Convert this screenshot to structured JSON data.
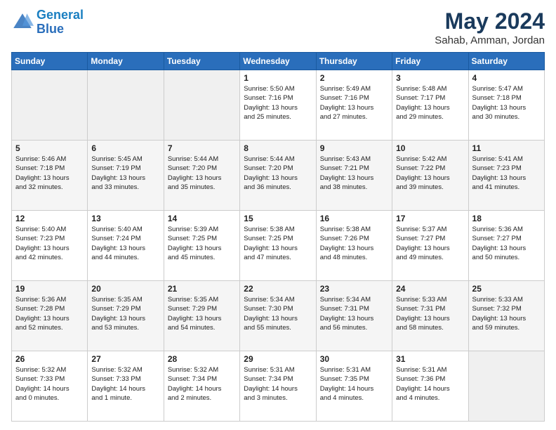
{
  "logo": {
    "line1": "General",
    "line2": "Blue"
  },
  "title": "May 2024",
  "subtitle": "Sahab, Amman, Jordan",
  "weekdays": [
    "Sunday",
    "Monday",
    "Tuesday",
    "Wednesday",
    "Thursday",
    "Friday",
    "Saturday"
  ],
  "weeks": [
    [
      {
        "day": "",
        "info": ""
      },
      {
        "day": "",
        "info": ""
      },
      {
        "day": "",
        "info": ""
      },
      {
        "day": "1",
        "info": "Sunrise: 5:50 AM\nSunset: 7:16 PM\nDaylight: 13 hours\nand 25 minutes."
      },
      {
        "day": "2",
        "info": "Sunrise: 5:49 AM\nSunset: 7:16 PM\nDaylight: 13 hours\nand 27 minutes."
      },
      {
        "day": "3",
        "info": "Sunrise: 5:48 AM\nSunset: 7:17 PM\nDaylight: 13 hours\nand 29 minutes."
      },
      {
        "day": "4",
        "info": "Sunrise: 5:47 AM\nSunset: 7:18 PM\nDaylight: 13 hours\nand 30 minutes."
      }
    ],
    [
      {
        "day": "5",
        "info": "Sunrise: 5:46 AM\nSunset: 7:18 PM\nDaylight: 13 hours\nand 32 minutes."
      },
      {
        "day": "6",
        "info": "Sunrise: 5:45 AM\nSunset: 7:19 PM\nDaylight: 13 hours\nand 33 minutes."
      },
      {
        "day": "7",
        "info": "Sunrise: 5:44 AM\nSunset: 7:20 PM\nDaylight: 13 hours\nand 35 minutes."
      },
      {
        "day": "8",
        "info": "Sunrise: 5:44 AM\nSunset: 7:20 PM\nDaylight: 13 hours\nand 36 minutes."
      },
      {
        "day": "9",
        "info": "Sunrise: 5:43 AM\nSunset: 7:21 PM\nDaylight: 13 hours\nand 38 minutes."
      },
      {
        "day": "10",
        "info": "Sunrise: 5:42 AM\nSunset: 7:22 PM\nDaylight: 13 hours\nand 39 minutes."
      },
      {
        "day": "11",
        "info": "Sunrise: 5:41 AM\nSunset: 7:23 PM\nDaylight: 13 hours\nand 41 minutes."
      }
    ],
    [
      {
        "day": "12",
        "info": "Sunrise: 5:40 AM\nSunset: 7:23 PM\nDaylight: 13 hours\nand 42 minutes."
      },
      {
        "day": "13",
        "info": "Sunrise: 5:40 AM\nSunset: 7:24 PM\nDaylight: 13 hours\nand 44 minutes."
      },
      {
        "day": "14",
        "info": "Sunrise: 5:39 AM\nSunset: 7:25 PM\nDaylight: 13 hours\nand 45 minutes."
      },
      {
        "day": "15",
        "info": "Sunrise: 5:38 AM\nSunset: 7:25 PM\nDaylight: 13 hours\nand 47 minutes."
      },
      {
        "day": "16",
        "info": "Sunrise: 5:38 AM\nSunset: 7:26 PM\nDaylight: 13 hours\nand 48 minutes."
      },
      {
        "day": "17",
        "info": "Sunrise: 5:37 AM\nSunset: 7:27 PM\nDaylight: 13 hours\nand 49 minutes."
      },
      {
        "day": "18",
        "info": "Sunrise: 5:36 AM\nSunset: 7:27 PM\nDaylight: 13 hours\nand 50 minutes."
      }
    ],
    [
      {
        "day": "19",
        "info": "Sunrise: 5:36 AM\nSunset: 7:28 PM\nDaylight: 13 hours\nand 52 minutes."
      },
      {
        "day": "20",
        "info": "Sunrise: 5:35 AM\nSunset: 7:29 PM\nDaylight: 13 hours\nand 53 minutes."
      },
      {
        "day": "21",
        "info": "Sunrise: 5:35 AM\nSunset: 7:29 PM\nDaylight: 13 hours\nand 54 minutes."
      },
      {
        "day": "22",
        "info": "Sunrise: 5:34 AM\nSunset: 7:30 PM\nDaylight: 13 hours\nand 55 minutes."
      },
      {
        "day": "23",
        "info": "Sunrise: 5:34 AM\nSunset: 7:31 PM\nDaylight: 13 hours\nand 56 minutes."
      },
      {
        "day": "24",
        "info": "Sunrise: 5:33 AM\nSunset: 7:31 PM\nDaylight: 13 hours\nand 58 minutes."
      },
      {
        "day": "25",
        "info": "Sunrise: 5:33 AM\nSunset: 7:32 PM\nDaylight: 13 hours\nand 59 minutes."
      }
    ],
    [
      {
        "day": "26",
        "info": "Sunrise: 5:32 AM\nSunset: 7:33 PM\nDaylight: 14 hours\nand 0 minutes."
      },
      {
        "day": "27",
        "info": "Sunrise: 5:32 AM\nSunset: 7:33 PM\nDaylight: 14 hours\nand 1 minute."
      },
      {
        "day": "28",
        "info": "Sunrise: 5:32 AM\nSunset: 7:34 PM\nDaylight: 14 hours\nand 2 minutes."
      },
      {
        "day": "29",
        "info": "Sunrise: 5:31 AM\nSunset: 7:34 PM\nDaylight: 14 hours\nand 3 minutes."
      },
      {
        "day": "30",
        "info": "Sunrise: 5:31 AM\nSunset: 7:35 PM\nDaylight: 14 hours\nand 4 minutes."
      },
      {
        "day": "31",
        "info": "Sunrise: 5:31 AM\nSunset: 7:36 PM\nDaylight: 14 hours\nand 4 minutes."
      },
      {
        "day": "",
        "info": ""
      }
    ]
  ]
}
